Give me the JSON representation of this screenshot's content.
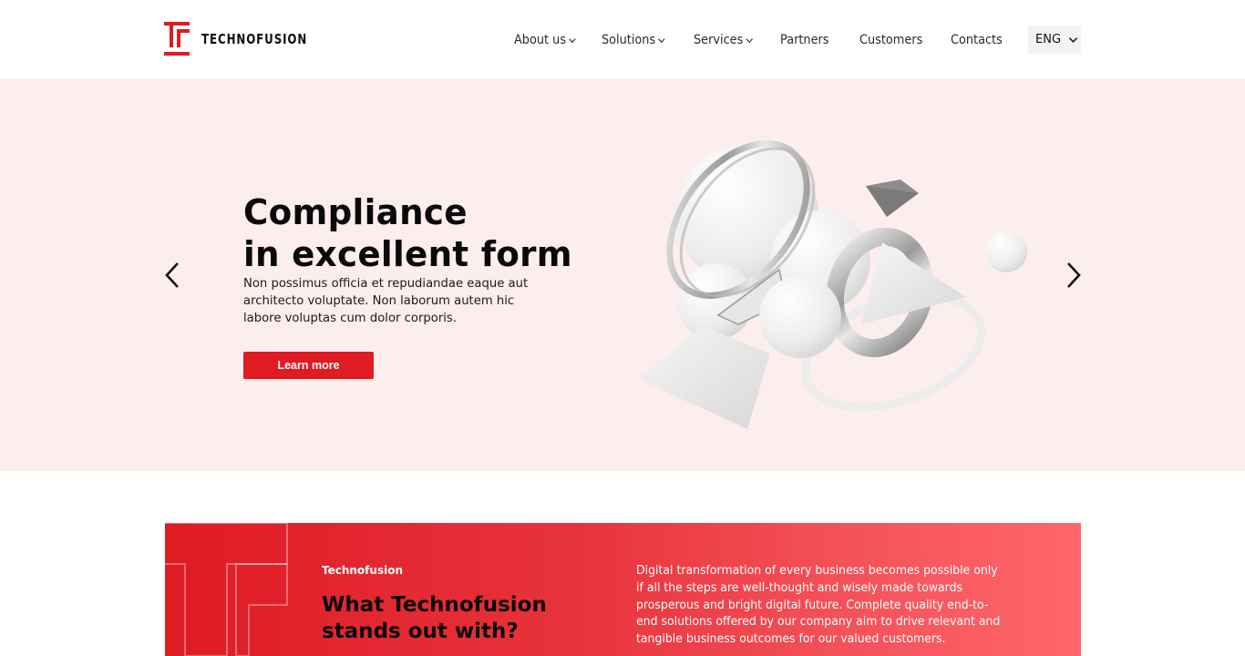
{
  "brand": {
    "name": "TECHNOFUSION",
    "primary_color": "#e01b22",
    "hero_bg": "#fdeeee"
  },
  "nav": {
    "items": [
      {
        "label": "About us",
        "has_dropdown": true
      },
      {
        "label": "Solutions",
        "has_dropdown": true
      },
      {
        "label": "Services",
        "has_dropdown": true
      },
      {
        "label": "Partners",
        "has_dropdown": false
      },
      {
        "label": "Customers",
        "has_dropdown": false
      },
      {
        "label": "Contacts",
        "has_dropdown": false
      }
    ],
    "language": "ENG"
  },
  "hero": {
    "title_line1": "Compliance",
    "title_line2": "in excellent form",
    "description": "Non possimus officia et repudiandae eaque aut architecto voluptate. Non laborum autem hic labore voluptas cum dolor corporis.",
    "cta_label": "Learn more",
    "prev_icon": "chevron-left-icon",
    "next_icon": "chevron-right-icon",
    "illustration": "abstract-3d-shapes"
  },
  "feature": {
    "eyebrow": "Technofusion",
    "title_line1": "What Technofusion",
    "title_line2": "stands out with?",
    "text": "Digital transformation of every business becomes possible only if all the steps are well-thought and wisely made towards prosperous and bright digital future. Complete quality end-to-end solutions offered by our company aim to drive relevant and tangible business outcomes for our valued customers."
  }
}
